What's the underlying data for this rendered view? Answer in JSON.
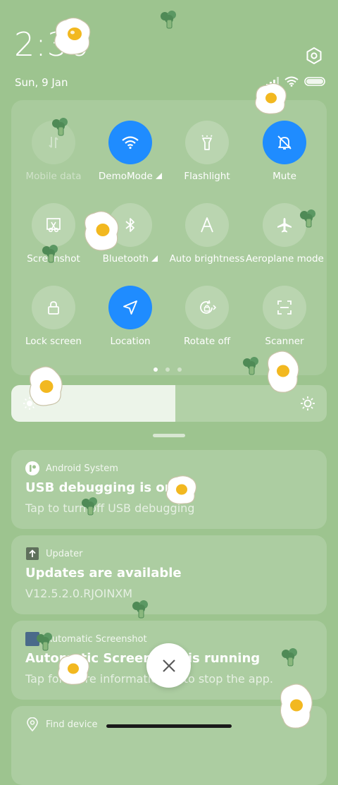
{
  "status": {
    "time": "2:36",
    "date": "Sun, 9 Jan"
  },
  "icons": {
    "settings": "settings-icon",
    "signal": "signal-icon",
    "wifi": "wifi-icon",
    "battery": "battery-icon"
  },
  "tiles": [
    {
      "label": "Mobile data",
      "icon": "mobile-data-icon",
      "state": "disabled"
    },
    {
      "label": "DemoMode",
      "icon": "wifi-icon",
      "state": "on"
    },
    {
      "label": "Flashlight",
      "icon": "flashlight-icon",
      "state": "off"
    },
    {
      "label": "Mute",
      "icon": "bell-off-icon",
      "state": "on"
    },
    {
      "label": "Screenshot",
      "icon": "screenshot-icon",
      "state": "off"
    },
    {
      "label": "Bluetooth",
      "icon": "bluetooth-icon",
      "state": "off"
    },
    {
      "label": "Auto brightness",
      "icon": "auto-brightness-icon",
      "state": "off"
    },
    {
      "label": "Aeroplane mode",
      "icon": "airplane-icon",
      "state": "off"
    },
    {
      "label": "Lock screen",
      "icon": "lock-icon",
      "state": "off"
    },
    {
      "label": "Location",
      "icon": "location-icon",
      "state": "on"
    },
    {
      "label": "Rotate off",
      "icon": "rotate-lock-icon",
      "state": "off"
    },
    {
      "label": "Scanner",
      "icon": "scanner-icon",
      "state": "off"
    }
  ],
  "pager": {
    "pages": 3,
    "current": 1
  },
  "brightness": {
    "level": 0.52
  },
  "notifications": [
    {
      "app": "Android System",
      "title": "USB debugging is on",
      "text": "Tap to turn off USB debugging"
    },
    {
      "app": "Updater",
      "title": "Updates are available",
      "text": "V12.5.2.0.RJOINXM"
    },
    {
      "app": "Automatic Screenshot",
      "title": "Automatic Screenshot is running",
      "text": "Tap for more information or to stop the app."
    },
    {
      "app": "Find device",
      "title": "",
      "text": ""
    }
  ],
  "colors": {
    "background": "#9dc48f",
    "accent": "#1f8cff"
  }
}
